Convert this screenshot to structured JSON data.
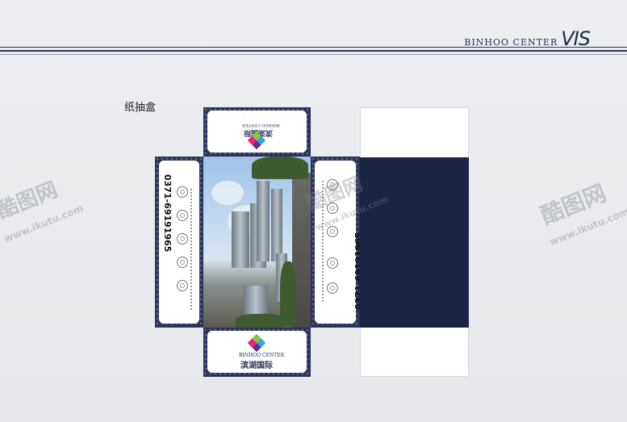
{
  "header": {
    "brand_name": "BINHOO CENTER",
    "brand_suffix": "VIS"
  },
  "section": {
    "title": "纸抽盒"
  },
  "box": {
    "top_flap": {
      "brand_en": "BINHOO CENTER",
      "brand_cn": "滨湖国际"
    },
    "bottom_flap": {
      "brand_en": "BINHOO CENTER",
      "brand_cn": "滨湖国际"
    },
    "left_side": {
      "phone": "0371-69191965"
    },
    "right_side": {
      "phone": "0371-69191965"
    }
  },
  "watermarks": [
    {
      "brand": "酷图网",
      "url": "www.ikutu.com"
    },
    {
      "brand": "酷图网",
      "url": "www.ikutu.com"
    },
    {
      "brand": "酷图网",
      "url": "www.ikutu.com"
    }
  ],
  "colors": {
    "navy": "#1c2443",
    "pattern": "#2b3355",
    "page_bg": "#e9ebee"
  }
}
